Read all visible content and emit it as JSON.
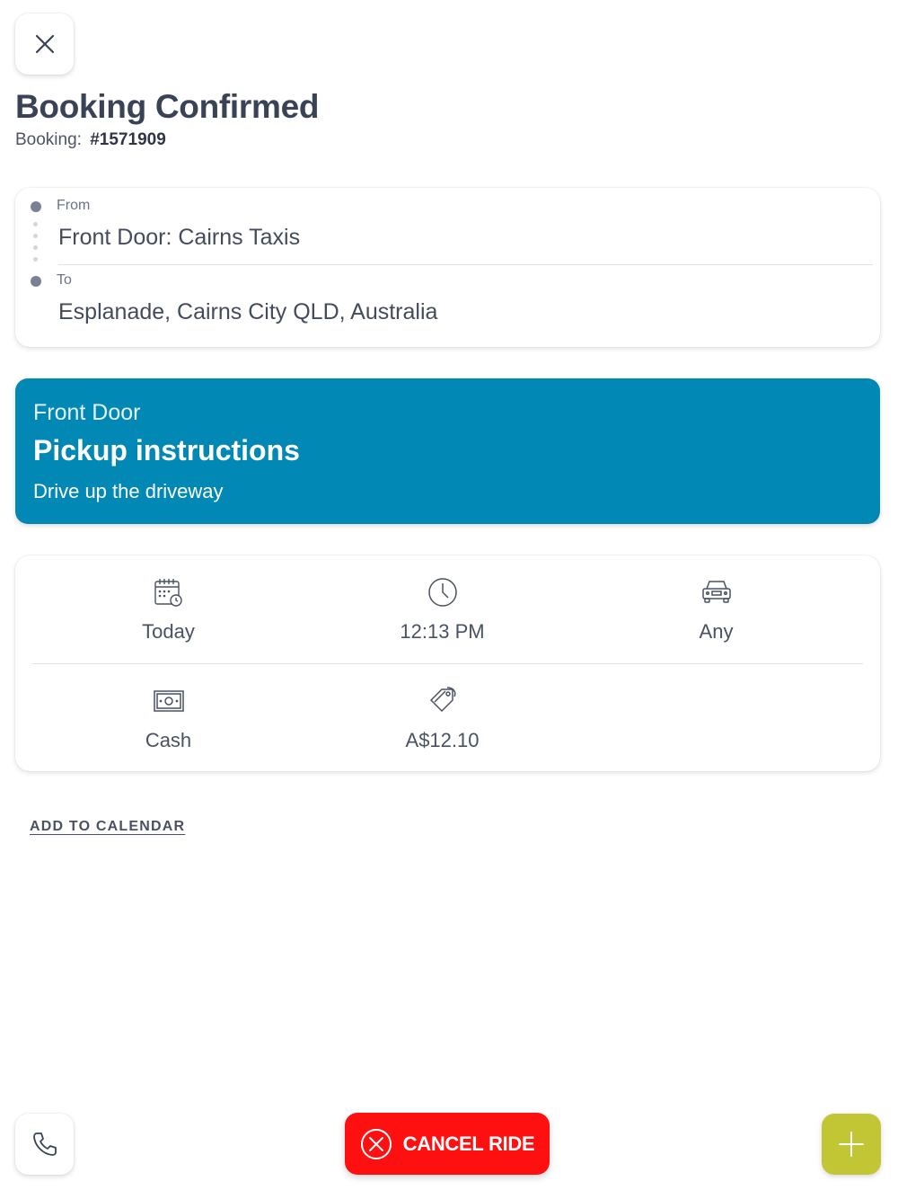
{
  "header": {
    "title": "Booking Confirmed",
    "booking_label": "Booking:",
    "booking_number": "#1571909"
  },
  "route": {
    "from_label": "From",
    "from_value": "Front Door: Cairns Taxis",
    "to_label": "To",
    "to_value": "Esplanade, Cairns City QLD, Australia"
  },
  "pickup": {
    "location": "Front Door",
    "heading": "Pickup instructions",
    "instructions": "Drive up the driveway",
    "color": "#0288b4"
  },
  "details": {
    "date": {
      "icon": "calendar-clock-icon",
      "label": "Today"
    },
    "time": {
      "icon": "clock-icon",
      "label": "12:13 PM"
    },
    "vehicle": {
      "icon": "car-icon",
      "label": "Any"
    },
    "payment": {
      "icon": "cash-icon",
      "label": "Cash"
    },
    "price": {
      "icon": "price-tag-icon",
      "label": "A$12.10"
    }
  },
  "actions": {
    "add_to_calendar": "ADD TO CALENDAR",
    "cancel_ride": "CANCEL RIDE",
    "cancel_color": "#ff1010",
    "add_color": "#c3c634",
    "close_icon": "close-icon",
    "phone_icon": "phone-icon",
    "plus_icon": "plus-icon"
  }
}
